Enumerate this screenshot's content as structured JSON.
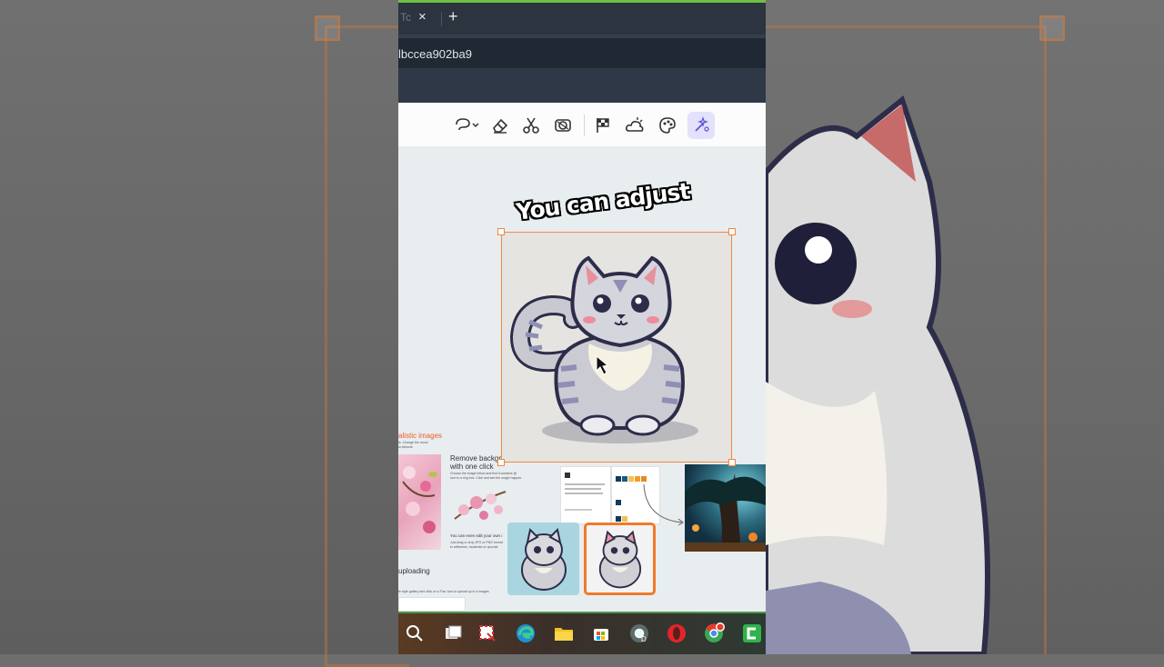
{
  "browser": {
    "tab_fragment": "Tc",
    "close_glyph": "×",
    "new_tab_glyph": "+",
    "address_text": "lbccea902ba9"
  },
  "toolbar": {
    "tools": [
      {
        "name": "lasso-icon",
        "active": false
      },
      {
        "name": "eraser-icon",
        "active": false
      },
      {
        "name": "scissors-icon",
        "active": false
      },
      {
        "name": "mask-icon",
        "active": false
      },
      {
        "name": "flag-icon",
        "active": false
      },
      {
        "name": "weather-icon",
        "active": false
      },
      {
        "name": "palette-icon",
        "active": false
      },
      {
        "name": "magic-wand-icon",
        "active": true
      }
    ],
    "active_color": "#e3e1fb"
  },
  "overlay": {
    "caption": "You can adjust"
  },
  "collage": {
    "realistic_heading": "alistic images",
    "realistic_sub": "ts. Change the mood\nur Artwork",
    "remove_bg_heading": "Remove backgr\nwith one click",
    "remove_bg_desc": "Choose the image below and find it contains @\nicon in a ring box. Click and see the magic happen.",
    "own_image_heading": "You can even edit your own i",
    "own_image_desc": "Just drag or drop JPG or PNG format\nto artframes, moderate or upscale",
    "uploading_label": "uploading",
    "footer_desc": "fe style gallery and click on a 'Fas' icon to upload up to 4 images",
    "accent_color": "#f05a28"
  },
  "taskbar": {
    "icons": [
      "search-icon",
      "task-view-icon",
      "snipping-icon",
      "edge-icon",
      "file-explorer-icon",
      "store-icon",
      "chrome-dev-icon",
      "opera-icon",
      "chrome-icon",
      "camtasia-icon"
    ]
  }
}
